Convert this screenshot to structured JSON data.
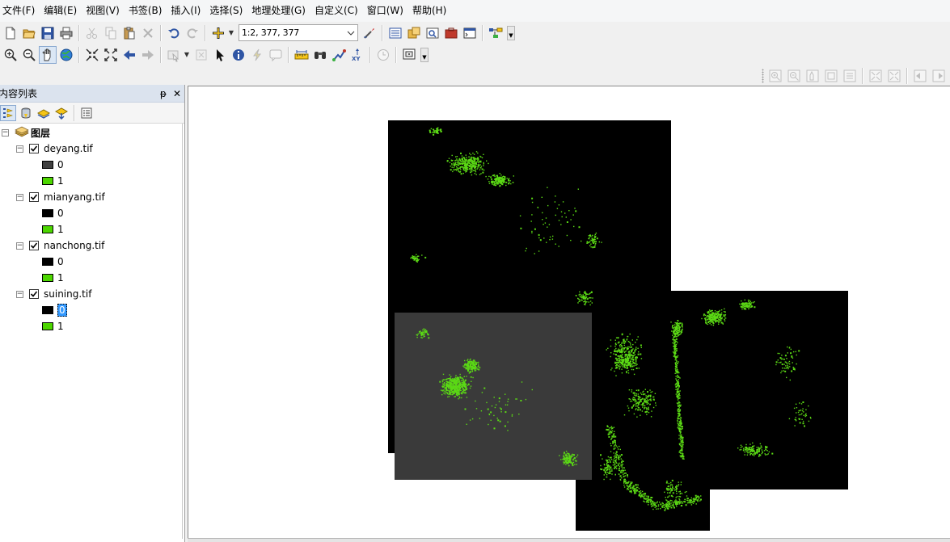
{
  "menu": [
    {
      "id": "file",
      "label": "文件(F)"
    },
    {
      "id": "edit",
      "label": "编辑(E)"
    },
    {
      "id": "view",
      "label": "视图(V)"
    },
    {
      "id": "bookmarks",
      "label": "书签(B)"
    },
    {
      "id": "insert",
      "label": "插入(I)"
    },
    {
      "id": "selection",
      "label": "选择(S)"
    },
    {
      "id": "geoprocessing",
      "label": "地理处理(G)"
    },
    {
      "id": "customize",
      "label": "自定义(C)"
    },
    {
      "id": "windows",
      "label": "窗口(W)"
    },
    {
      "id": "help",
      "label": "帮助(H)"
    }
  ],
  "toolbar": {
    "scale_value": "1:2, 377, 377",
    "standard_icons": [
      "new-document-icon",
      "open-folder-icon",
      "save-icon",
      "print-icon",
      "cut-icon",
      "copy-icon",
      "paste-icon",
      "delete-icon",
      "undo-icon",
      "redo-icon",
      "add-data-icon"
    ],
    "tools_icons": [
      "zoom-in-icon",
      "zoom-out-icon",
      "pan-icon",
      "full-extent-icon",
      "fixed-zoom-in-icon",
      "fixed-zoom-out-icon",
      "back-extent-icon",
      "forward-extent-icon",
      "select-features-icon",
      "clear-selection-icon",
      "select-elements-icon",
      "identify-icon",
      "hyperlink-icon",
      "html-popup-icon",
      "measure-icon",
      "find-icon",
      "find-route-icon",
      "go-to-xy-icon",
      "time-slider-icon",
      "create-viewer-icon"
    ]
  },
  "toc": {
    "title": "内容列表",
    "pin_glyph": "ᵽ",
    "close_glyph": "✕",
    "group_name": "图层",
    "layers": [
      {
        "name": "deyang.tif",
        "checked": true,
        "classes": [
          {
            "label": "0",
            "color": "#404040"
          },
          {
            "label": "1",
            "color": "#4cd600"
          }
        ]
      },
      {
        "name": "mianyang.tif",
        "checked": true,
        "classes": [
          {
            "label": "0",
            "color": "#000000"
          },
          {
            "label": "1",
            "color": "#4cd600"
          }
        ]
      },
      {
        "name": "nanchong.tif",
        "checked": true,
        "classes": [
          {
            "label": "0",
            "color": "#000000"
          },
          {
            "label": "1",
            "color": "#4cd600"
          }
        ]
      },
      {
        "name": "suining.tif",
        "checked": true,
        "classes": [
          {
            "label": "0",
            "color": "#000000",
            "selected": true
          },
          {
            "label": "1",
            "color": "#4cd600"
          }
        ]
      }
    ]
  },
  "map": {
    "background_color": "#000000",
    "deyang_zero_color": "#3a3a3a",
    "class_one_color": "#5bd915",
    "rasters": [
      "mianyang.tif",
      "nanchong.tif",
      "suining.tif",
      "deyang.tif"
    ]
  },
  "colors": {
    "selection_highlight": "#3399ff",
    "panel_header": "#dbe3ee"
  }
}
